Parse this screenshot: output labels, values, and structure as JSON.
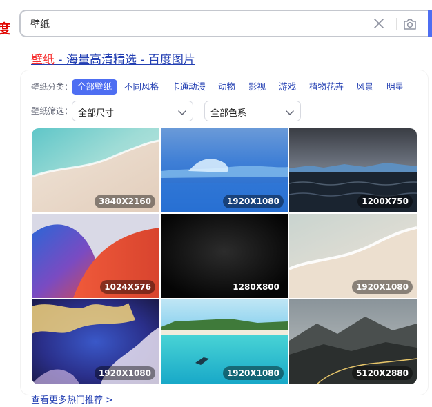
{
  "logo_fragment": "度",
  "search": {
    "value": "壁纸"
  },
  "result": {
    "title_keyword": "壁纸",
    "title_rest": " - 海量高清精选 - 百度图片"
  },
  "categories": {
    "label": "壁纸分类：",
    "items": [
      "全部壁纸",
      "不同风格",
      "卡通动漫",
      "动物",
      "影视",
      "游戏",
      "植物花卉",
      "风景",
      "明星"
    ],
    "active_index": 0
  },
  "filters": {
    "label": "壁纸筛选：",
    "size_value": "全部尺寸",
    "color_value": "全部色系"
  },
  "images": [
    {
      "resolution": "3840X2160",
      "subject": "beach-shore-aerial"
    },
    {
      "resolution": "1920X1080",
      "subject": "blue-wave-long-exposure"
    },
    {
      "resolution": "1200X750",
      "subject": "dark-sea-cloudy-sky"
    },
    {
      "resolution": "1024X576",
      "subject": "abstract-red-blue-waves"
    },
    {
      "resolution": "1280X800",
      "subject": "dark-texture"
    },
    {
      "resolution": "1920X1080",
      "subject": "sandy-beach-foam"
    },
    {
      "resolution": "1920X1080",
      "subject": "fantasy-cloud-sky"
    },
    {
      "resolution": "1920X1080",
      "subject": "tropical-lagoon-snorkeler"
    },
    {
      "resolution": "5120X2880",
      "subject": "mountain-road-dusk"
    }
  ],
  "more_link": "查看更多热门推荐 >",
  "colors": {
    "accent": "#4e6ef2",
    "link": "#2440b3",
    "highlight": "#f73131",
    "logo": "#e10601"
  }
}
